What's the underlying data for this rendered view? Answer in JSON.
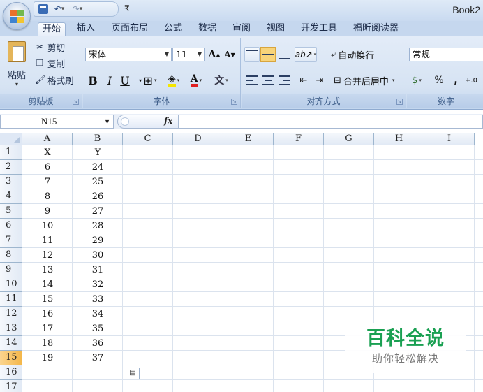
{
  "title_bar": {
    "doc_title": "Book2",
    "qat": {
      "save_icon": "save-icon",
      "undo_icon": "undo-icon",
      "redo_icon": "redo-icon",
      "customize_glyph": "₹"
    }
  },
  "tabs": [
    {
      "label": "开始",
      "active": true
    },
    {
      "label": "插入"
    },
    {
      "label": "页面布局"
    },
    {
      "label": "公式"
    },
    {
      "label": "数据"
    },
    {
      "label": "审阅"
    },
    {
      "label": "视图"
    },
    {
      "label": "开发工具"
    },
    {
      "label": "福昕阅读器"
    }
  ],
  "ribbon": {
    "clipboard": {
      "label": "剪贴板",
      "paste": "粘贴",
      "cut": "剪切",
      "copy": "复制",
      "format_painter": "格式刷"
    },
    "font": {
      "label": "字体",
      "font_name": "宋体",
      "font_size": "11",
      "grow": "A",
      "shrink": "A",
      "bold": "B",
      "italic": "I",
      "underline": "U",
      "border_icon": "border-icon",
      "fill_icon": "fill-color-icon",
      "font_color_glyph": "A",
      "phonetic_glyph": "文",
      "font_color": "#e02020",
      "fill_color": "#f5e600"
    },
    "alignment": {
      "label": "对齐方式",
      "wrap_text": "自动换行",
      "merge_center": "合并后居中"
    },
    "number": {
      "label": "数字",
      "format": "常规",
      "currency_glyph": "$",
      "percent": "%",
      "comma": ",",
      "increase_decimal": "+.0"
    }
  },
  "formula_bar": {
    "name_box": "N15",
    "fx": "fx",
    "formula": ""
  },
  "sheet": {
    "columns": [
      "A",
      "B",
      "C",
      "D",
      "E",
      "F",
      "G",
      "H",
      "I"
    ],
    "rows": [
      "1",
      "2",
      "3",
      "4",
      "5",
      "6",
      "7",
      "8",
      "9",
      "10",
      "11",
      "12",
      "13",
      "14",
      "15",
      "16",
      "17"
    ],
    "active_row": "15",
    "data": [
      [
        "X",
        "Y"
      ],
      [
        "6",
        "24"
      ],
      [
        "7",
        "25"
      ],
      [
        "8",
        "26"
      ],
      [
        "9",
        "27"
      ],
      [
        "10",
        "28"
      ],
      [
        "11",
        "29"
      ],
      [
        "12",
        "30"
      ],
      [
        "13",
        "31"
      ],
      [
        "14",
        "32"
      ],
      [
        "15",
        "33"
      ],
      [
        "16",
        "34"
      ],
      [
        "17",
        "35"
      ],
      [
        "18",
        "36"
      ],
      [
        "19",
        "37"
      ]
    ]
  },
  "watermark": {
    "main": "百科全说",
    "sub": "助你轻松解决"
  }
}
